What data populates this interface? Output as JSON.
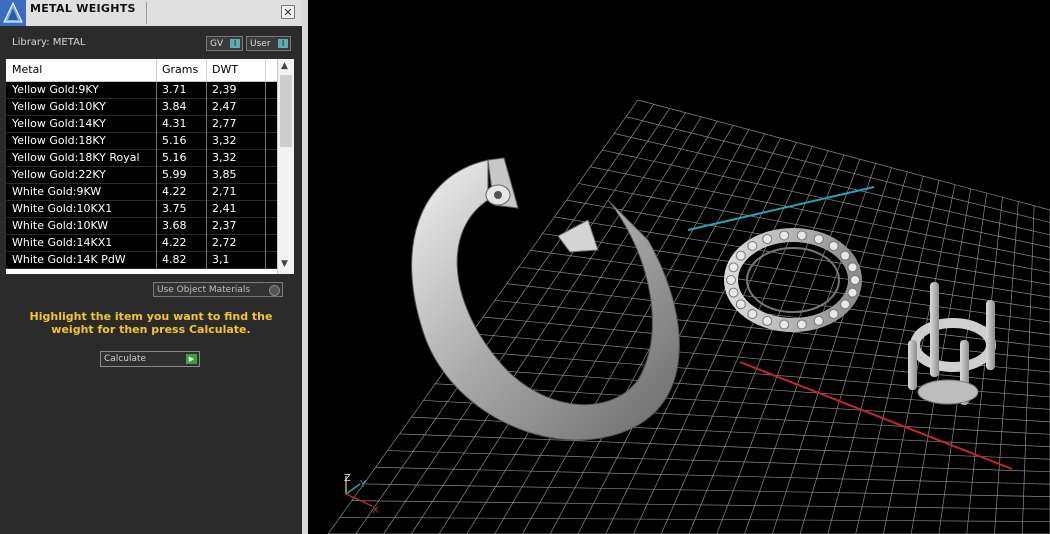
{
  "panel": {
    "title": "METAL WEIGHTS",
    "close": "✕",
    "library_label": "Library: METAL",
    "toggle_gv": "GV",
    "toggle_user": "User",
    "toggle_icon": "I",
    "columns": [
      "Metal",
      "Grams",
      "DWT"
    ],
    "rows": [
      {
        "metal": "Yellow Gold:9KY",
        "grams": "3.71",
        "dwt": "2,39"
      },
      {
        "metal": "Yellow Gold:10KY",
        "grams": "3.84",
        "dwt": "2,47"
      },
      {
        "metal": "Yellow Gold:14KY",
        "grams": "4.31",
        "dwt": "2,77"
      },
      {
        "metal": "Yellow Gold:18KY",
        "grams": "5.16",
        "dwt": "3,32"
      },
      {
        "metal": "Yellow Gold:18KY Royal",
        "grams": "5.16",
        "dwt": "3,32"
      },
      {
        "metal": "Yellow Gold:22KY",
        "grams": "5.99",
        "dwt": "3,85"
      },
      {
        "metal": "White Gold:9KW",
        "grams": "4.22",
        "dwt": "2,71"
      },
      {
        "metal": "White Gold:10KX1",
        "grams": "3.75",
        "dwt": "2,41"
      },
      {
        "metal": "White Gold:10KW",
        "grams": "3.68",
        "dwt": "2,37"
      },
      {
        "metal": "White Gold:14KX1",
        "grams": "4.22",
        "dwt": "2,72"
      },
      {
        "metal": "White Gold:14K PdW",
        "grams": "4.82",
        "dwt": "3,1"
      }
    ],
    "use_object_materials": "Use Object Materials",
    "hint": "Highlight the item you want to find the weight for then press Calculate.",
    "calculate_label": "Calculate",
    "calculate_icon": "▶"
  },
  "viewport": {
    "axis_labels": {
      "z": "Z",
      "y": "Y",
      "x": "X"
    }
  },
  "colors": {
    "hint": "#f3c531",
    "x_axis": "#c0282b",
    "y_axis": "#2aa0b8",
    "grid": "#8a8a8a"
  }
}
